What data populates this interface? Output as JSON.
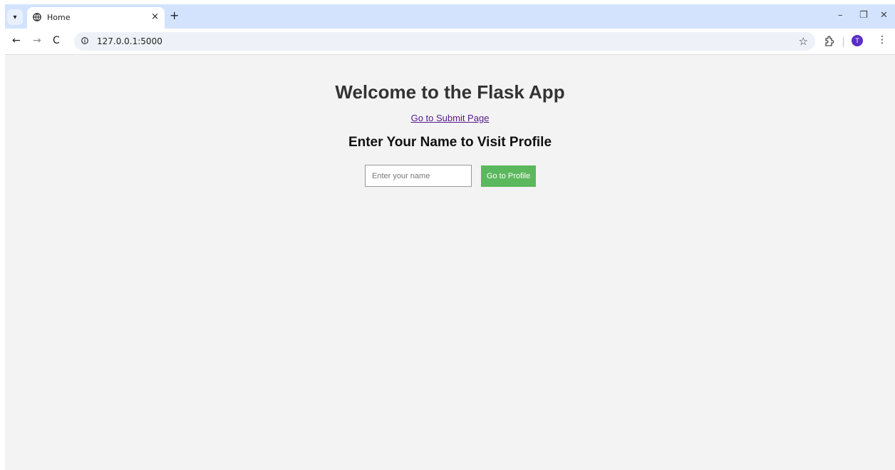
{
  "browser": {
    "tab": {
      "title": "Home",
      "close_glyph": "×"
    },
    "new_tab_glyph": "+",
    "url": "127.0.0.1:5000",
    "profile_initial": "T",
    "window_controls": {
      "minimize": "–",
      "restore": "❐",
      "close": "✕"
    },
    "nav": {
      "back": "←",
      "forward": "→",
      "reload": "C"
    },
    "star_glyph": "☆",
    "menu_glyph": "⋮",
    "accent": "#d3e3fd",
    "avatar_color": "#5b2fc7"
  },
  "page": {
    "title": "Welcome to the Flask App",
    "submit_link_text": "Go to Submit Page",
    "section_title": "Enter Your Name to Visit Profile",
    "name_input": {
      "placeholder": "Enter your name",
      "value": ""
    },
    "profile_button_label": "Go to Profile",
    "button_color": "#5cb85c",
    "background": "#f3f3f3"
  }
}
